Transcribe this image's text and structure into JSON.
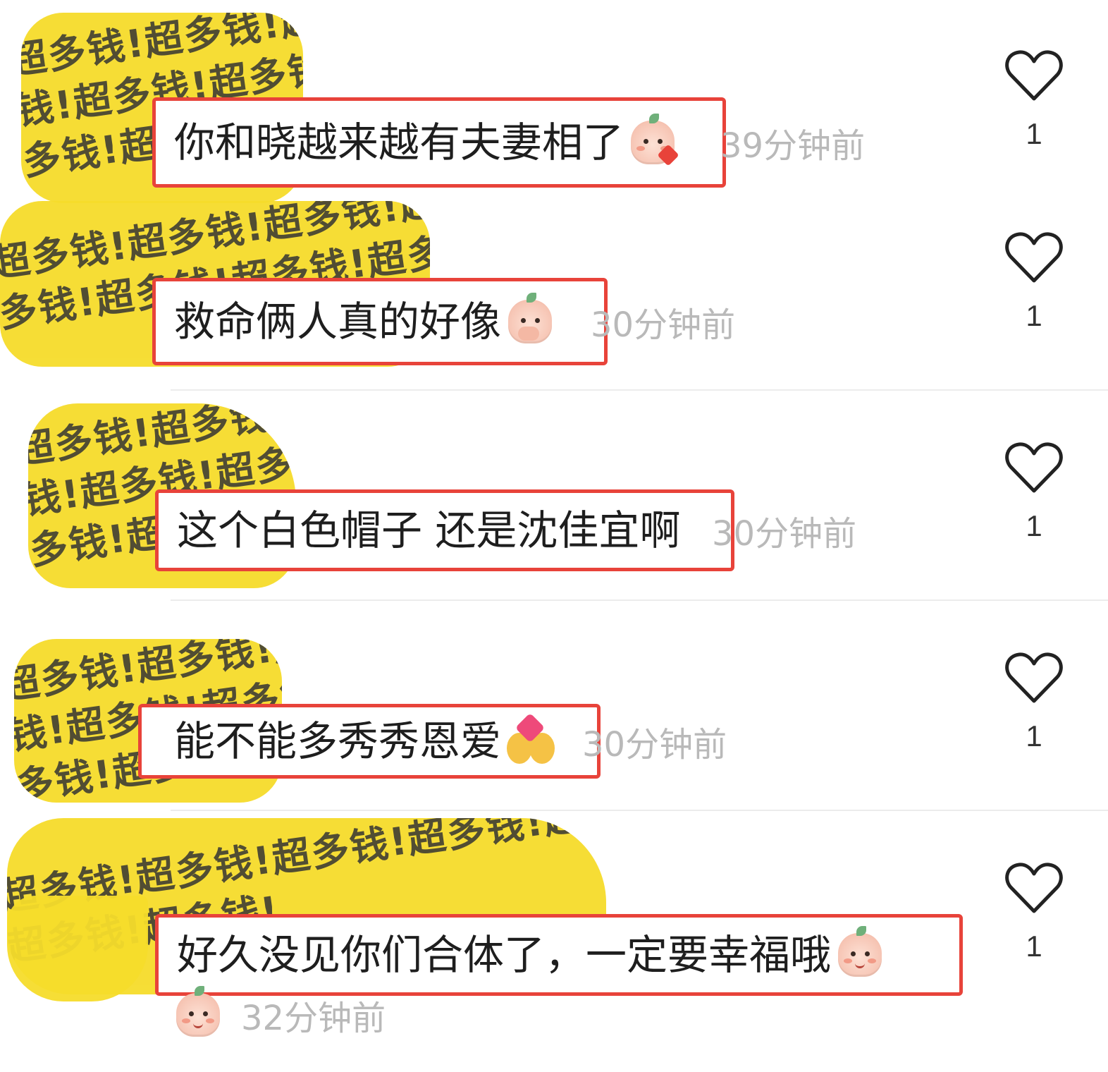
{
  "comments": [
    {
      "text": "你和晓越来越有夫妻相了",
      "time": "39分钟前",
      "likes": "1",
      "emoji": "blush-kiss-sticker"
    },
    {
      "text": "救命俩人真的好像",
      "time": "30分钟前",
      "likes": "1",
      "emoji": "shy-cover-mouth-sticker"
    },
    {
      "text": "这个白色帽子 还是沈佳宜啊",
      "time": "30分钟前",
      "likes": "1",
      "emoji": ""
    },
    {
      "text": "能不能多秀秀恩爱",
      "time": "30分钟前",
      "likes": "1",
      "emoji": "couple-kiss-emoji"
    },
    {
      "text": "好久没见你们合体了，一定要幸福哦",
      "time": "32分钟前",
      "likes": "1",
      "emoji": "smile-sticker"
    }
  ],
  "censor_watermark": "超多钱!超多钱!超多钱!超多钱!超多钱!超多钱!超多钱!超多钱!",
  "colors": {
    "highlight_box": "#e8433a",
    "censor_yellow": "#f6dc2b",
    "timestamp": "#b9b9b9"
  }
}
